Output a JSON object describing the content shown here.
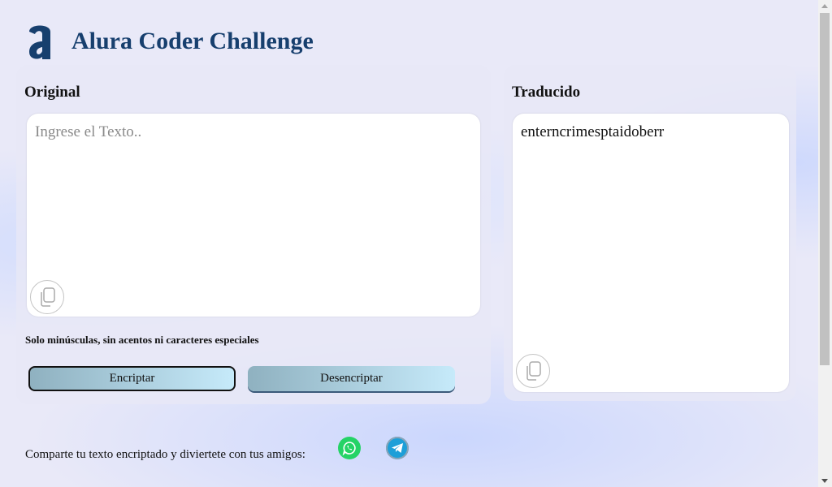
{
  "header": {
    "title": "Alura Coder Challenge",
    "logo_icon": "alura-a-logo"
  },
  "original": {
    "label": "Original",
    "placeholder": "Ingrese el Texto..",
    "copy_icon": "copy-icon",
    "hint": "Solo minúsculas, sin acentos ni caracteres especiales",
    "encrypt_label": "Encriptar",
    "decrypt_label": "Desencriptar"
  },
  "translated": {
    "label": "Traducido",
    "output": "enterncrimesptaidoberr",
    "copy_icon": "copy-icon"
  },
  "share": {
    "text": "Comparte tu texto encriptado y diviertete con tus amigos:",
    "icons": [
      "whatsapp-icon",
      "telegram-icon"
    ]
  },
  "colors": {
    "title": "#173f6e",
    "button_gradient_start": "#8fb1c0",
    "button_gradient_end": "#c6eafa",
    "whatsapp": "#25d366",
    "telegram": "#1d9fd8"
  }
}
